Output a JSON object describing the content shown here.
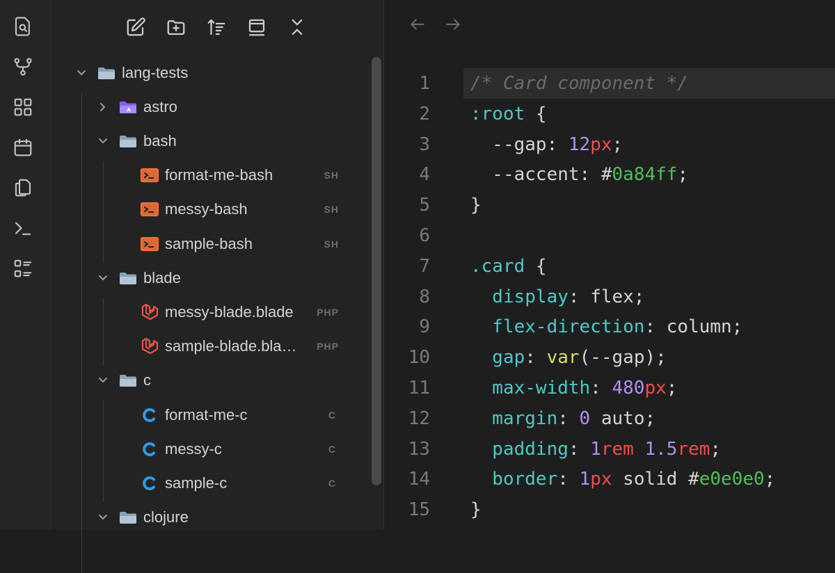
{
  "activity_bar": {
    "icons": [
      "file-search-icon",
      "source-control-icon",
      "extensions-icon",
      "calendar-icon",
      "copy-files-icon",
      "terminal-icon",
      "checklist-icon"
    ]
  },
  "toolbar": {
    "icons": [
      "new-file-icon",
      "new-folder-icon",
      "sort-icon",
      "collapse-panel-icon",
      "collapse-all-icon"
    ]
  },
  "tree": {
    "rows": [
      {
        "label": "lang-tests",
        "type": "folder",
        "expanded": true,
        "depth": 0,
        "badge": ""
      },
      {
        "label": "astro",
        "type": "astro-folder",
        "expanded": false,
        "depth": 1,
        "badge": ""
      },
      {
        "label": "bash",
        "type": "folder",
        "expanded": true,
        "depth": 1,
        "badge": ""
      },
      {
        "label": "format-me-bash",
        "type": "shell",
        "depth": 2,
        "badge": "SH"
      },
      {
        "label": "messy-bash",
        "type": "shell",
        "depth": 2,
        "badge": "SH"
      },
      {
        "label": "sample-bash",
        "type": "shell",
        "depth": 2,
        "badge": "SH"
      },
      {
        "label": "blade",
        "type": "folder",
        "expanded": true,
        "depth": 1,
        "badge": ""
      },
      {
        "label": "messy-blade.blade",
        "type": "laravel",
        "depth": 2,
        "badge": "PHP"
      },
      {
        "label": "sample-blade.bla…",
        "type": "laravel",
        "depth": 2,
        "badge": "PHP"
      },
      {
        "label": "c",
        "type": "folder",
        "expanded": true,
        "depth": 1,
        "badge": ""
      },
      {
        "label": "format-me-c",
        "type": "c",
        "depth": 2,
        "badge": "C"
      },
      {
        "label": "messy-c",
        "type": "c",
        "depth": 2,
        "badge": "C"
      },
      {
        "label": "sample-c",
        "type": "c",
        "depth": 2,
        "badge": "C"
      },
      {
        "label": "clojure",
        "type": "folder",
        "expanded": true,
        "depth": 1,
        "badge": ""
      }
    ]
  },
  "editor": {
    "lines": [
      {
        "n": "1",
        "tokens": [
          [
            "t-comment",
            "/* Card component */"
          ]
        ]
      },
      {
        "n": "2",
        "tokens": [
          [
            "t-sel",
            ":root"
          ],
          [
            "t-punct",
            " {"
          ]
        ]
      },
      {
        "n": "3",
        "tokens": [
          [
            "t-var",
            "  --gap"
          ],
          [
            "t-punct",
            ": "
          ],
          [
            "t-num",
            "12"
          ],
          [
            "t-unit",
            "px"
          ],
          [
            "t-punct",
            ";"
          ]
        ]
      },
      {
        "n": "4",
        "tokens": [
          [
            "t-var",
            "  --accent"
          ],
          [
            "t-punct",
            ": #"
          ],
          [
            "t-hex",
            "0a84ff"
          ],
          [
            "t-punct",
            ";"
          ]
        ]
      },
      {
        "n": "5",
        "tokens": [
          [
            "t-punct",
            "}"
          ]
        ]
      },
      {
        "n": "6",
        "tokens": []
      },
      {
        "n": "7",
        "tokens": [
          [
            "t-sel",
            ".card"
          ],
          [
            "t-punct",
            " {"
          ]
        ]
      },
      {
        "n": "8",
        "tokens": [
          [
            "t-prop",
            "  display"
          ],
          [
            "t-punct",
            ": flex;"
          ]
        ]
      },
      {
        "n": "9",
        "tokens": [
          [
            "t-prop",
            "  flex-direction"
          ],
          [
            "t-punct",
            ": column;"
          ]
        ]
      },
      {
        "n": "10",
        "tokens": [
          [
            "t-prop",
            "  gap"
          ],
          [
            "t-punct",
            ": "
          ],
          [
            "t-fn",
            "var"
          ],
          [
            "t-punct",
            "(--gap);"
          ]
        ]
      },
      {
        "n": "11",
        "tokens": [
          [
            "t-prop",
            "  max-width"
          ],
          [
            "t-punct",
            ": "
          ],
          [
            "t-num",
            "480"
          ],
          [
            "t-unit",
            "px"
          ],
          [
            "t-punct",
            ";"
          ]
        ]
      },
      {
        "n": "12",
        "tokens": [
          [
            "t-prop",
            "  margin"
          ],
          [
            "t-punct",
            ": "
          ],
          [
            "t-num",
            "0"
          ],
          [
            "t-punct",
            " auto;"
          ]
        ]
      },
      {
        "n": "13",
        "tokens": [
          [
            "t-prop",
            "  padding"
          ],
          [
            "t-punct",
            ": "
          ],
          [
            "t-num",
            "1"
          ],
          [
            "t-unit",
            "rem"
          ],
          [
            "t-punct",
            " "
          ],
          [
            "t-num",
            "1.5"
          ],
          [
            "t-unit",
            "rem"
          ],
          [
            "t-punct",
            ";"
          ]
        ]
      },
      {
        "n": "14",
        "tokens": [
          [
            "t-prop",
            "  border"
          ],
          [
            "t-punct",
            ": "
          ],
          [
            "t-num",
            "1"
          ],
          [
            "t-unit",
            "px"
          ],
          [
            "t-punct",
            " solid #"
          ],
          [
            "t-hex",
            "e0e0e0"
          ],
          [
            "t-punct",
            ";"
          ]
        ]
      },
      {
        "n": "15",
        "tokens": [
          [
            "t-punct",
            "}"
          ]
        ]
      }
    ]
  },
  "colors": {
    "folder": "#8aa3b8",
    "astro": "#8b5cf6",
    "shell": "#f0703a",
    "laravel": "#e8544a",
    "c_lang": "#2f9be8"
  }
}
